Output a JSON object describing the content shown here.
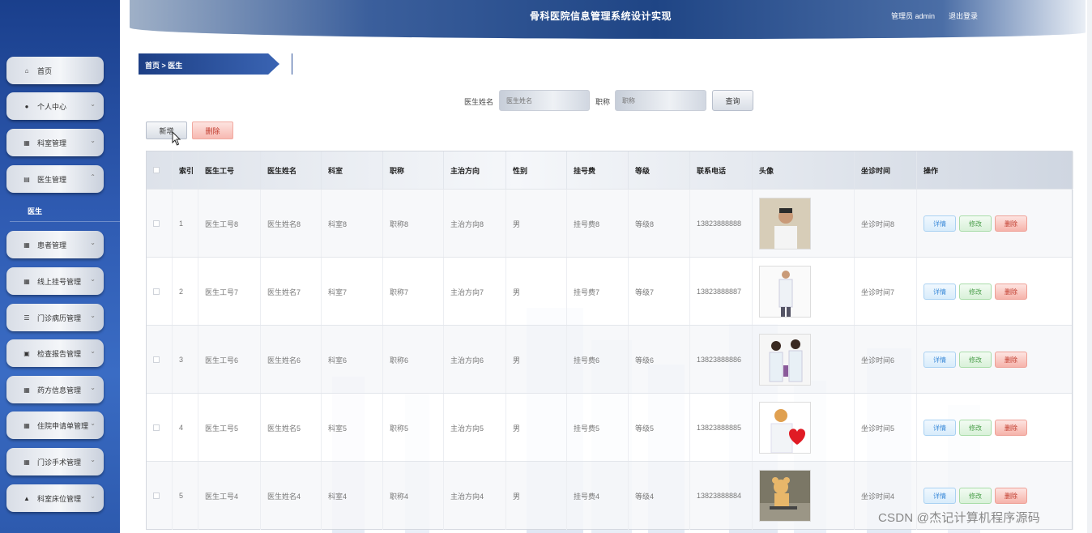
{
  "header": {
    "title": "骨科医院信息管理系统设计实现",
    "user": "管理员 admin",
    "logout": "退出登录"
  },
  "sidebar": {
    "items": [
      {
        "label": "首页",
        "icon": "home-icon",
        "glyph": "⌂",
        "chevron": ""
      },
      {
        "label": "个人中心",
        "icon": "person-icon",
        "glyph": "●",
        "chevron": "⌄"
      },
      {
        "label": "科室管理",
        "icon": "grid-icon",
        "glyph": "▦",
        "chevron": "⌄"
      },
      {
        "label": "医生管理",
        "icon": "doc-icon",
        "glyph": "▤",
        "chevron": "⌃"
      },
      {
        "label": "患者管理",
        "icon": "grid-icon",
        "glyph": "▦",
        "chevron": "⌄"
      },
      {
        "label": "线上挂号管理",
        "icon": "grid-icon",
        "glyph": "▦",
        "chevron": "⌄"
      },
      {
        "label": "门诊病历管理",
        "icon": "list-icon",
        "glyph": "☰",
        "chevron": "⌄"
      },
      {
        "label": "检查报告管理",
        "icon": "clipboard-icon",
        "glyph": "▣",
        "chevron": "⌄"
      },
      {
        "label": "药方信息管理",
        "icon": "grid-icon",
        "glyph": "▦",
        "chevron": "⌄"
      },
      {
        "label": "住院申请单管理",
        "icon": "grid-icon",
        "glyph": "▦",
        "chevron": "⌄"
      },
      {
        "label": "门诊手术管理",
        "icon": "grid-icon",
        "glyph": "▦",
        "chevron": "⌄"
      },
      {
        "label": "科室床位管理",
        "icon": "person-icon",
        "glyph": "▲",
        "chevron": "⌄"
      }
    ],
    "sub_item": "医生"
  },
  "breadcrumb": {
    "text": "首页 > 医生"
  },
  "search": {
    "name_label": "医生姓名",
    "name_placeholder": "医生姓名",
    "title_label": "职称",
    "title_placeholder": "职称",
    "query_button": "查询"
  },
  "actions": {
    "add": "新增",
    "delete": "删除"
  },
  "table": {
    "headers": [
      "",
      "索引",
      "医生工号",
      "医生姓名",
      "科室",
      "职称",
      "主治方向",
      "性别",
      "挂号费",
      "等级",
      "联系电话",
      "头像",
      "坐诊时间",
      "操作"
    ],
    "row_actions": {
      "detail": "详情",
      "edit": "修改",
      "remove": "删除"
    },
    "rows": [
      {
        "index": "1",
        "doctor_id": "医生工号8",
        "name": "医生姓名8",
        "dept": "科室8",
        "title": "职称8",
        "specialty": "主治方向8",
        "gender": "男",
        "fee": "挂号费8",
        "level": "等级8",
        "phone": "13823888888",
        "schedule": "坐诊时间8",
        "photo": "doctor-man-photo"
      },
      {
        "index": "2",
        "doctor_id": "医生工号7",
        "name": "医生姓名7",
        "dept": "科室7",
        "title": "职称7",
        "specialty": "主治方向7",
        "gender": "男",
        "fee": "挂号费7",
        "level": "等级7",
        "phone": "13823888887",
        "schedule": "坐诊时间7",
        "photo": "doctor-standing-photo"
      },
      {
        "index": "3",
        "doctor_id": "医生工号6",
        "name": "医生姓名6",
        "dept": "科室6",
        "title": "职称6",
        "specialty": "主治方向6",
        "gender": "男",
        "fee": "挂号费6",
        "level": "等级6",
        "phone": "13823888886",
        "schedule": "坐诊时间6",
        "photo": "two-nurses-photo"
      },
      {
        "index": "4",
        "doctor_id": "医生工号5",
        "name": "医生姓名5",
        "dept": "科室5",
        "title": "职称5",
        "specialty": "主治方向5",
        "gender": "男",
        "fee": "挂号费5",
        "level": "等级5",
        "phone": "13823888885",
        "schedule": "坐诊时间5",
        "photo": "nurse-heart-photo"
      },
      {
        "index": "5",
        "doctor_id": "医生工号4",
        "name": "医生姓名4",
        "dept": "科室4",
        "title": "职称4",
        "specialty": "主治方向4",
        "gender": "男",
        "fee": "挂号费4",
        "level": "等级4",
        "phone": "13823888884",
        "schedule": "坐诊时间4",
        "photo": "teddy-bear-photo"
      }
    ]
  },
  "watermark": "CSDN @杰记计算机程序源码",
  "colors": {
    "sidebar": "#2f5bb2",
    "header": "#1f4585",
    "danger": "#c0392b",
    "info": "#3b8ad9",
    "success": "#4a9e4a"
  }
}
